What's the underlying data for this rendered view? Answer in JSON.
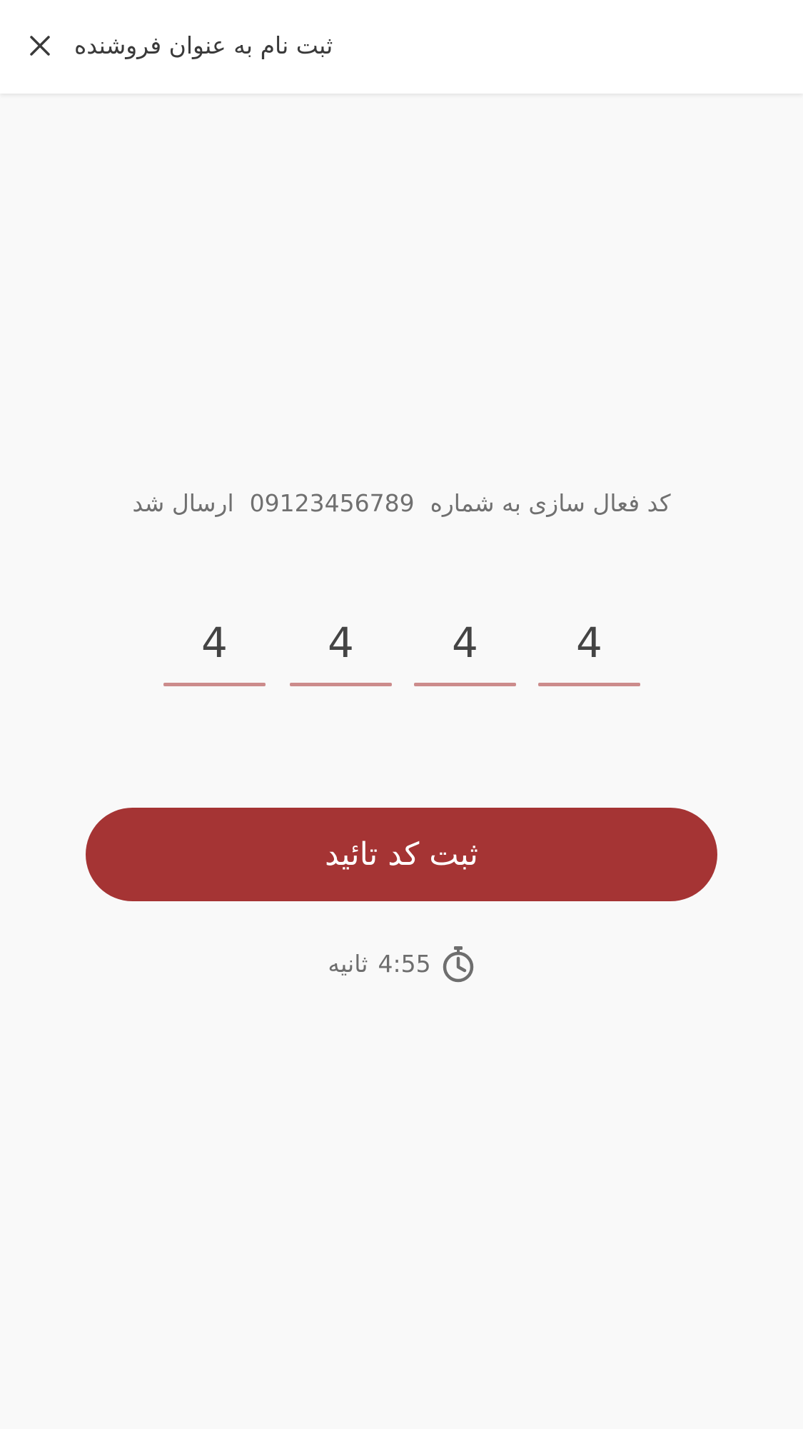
{
  "app_bar": {
    "title": "ثبت نام به عنوان فروشنده",
    "close_icon": "close-icon"
  },
  "verification": {
    "prefix": "کد فعال سازی به شماره",
    "phone": "09123456789",
    "suffix": "ارسال شد"
  },
  "otp": {
    "digits": [
      "4",
      "4",
      "4",
      "4"
    ]
  },
  "submit_label": "ثبت کد تائید",
  "timer": {
    "icon": "stopwatch-icon",
    "time": "4:55",
    "unit": "ثانیه"
  },
  "colors": {
    "primary": "#a53434",
    "underline": "#cc8c8c",
    "background": "#f9f9f9"
  }
}
